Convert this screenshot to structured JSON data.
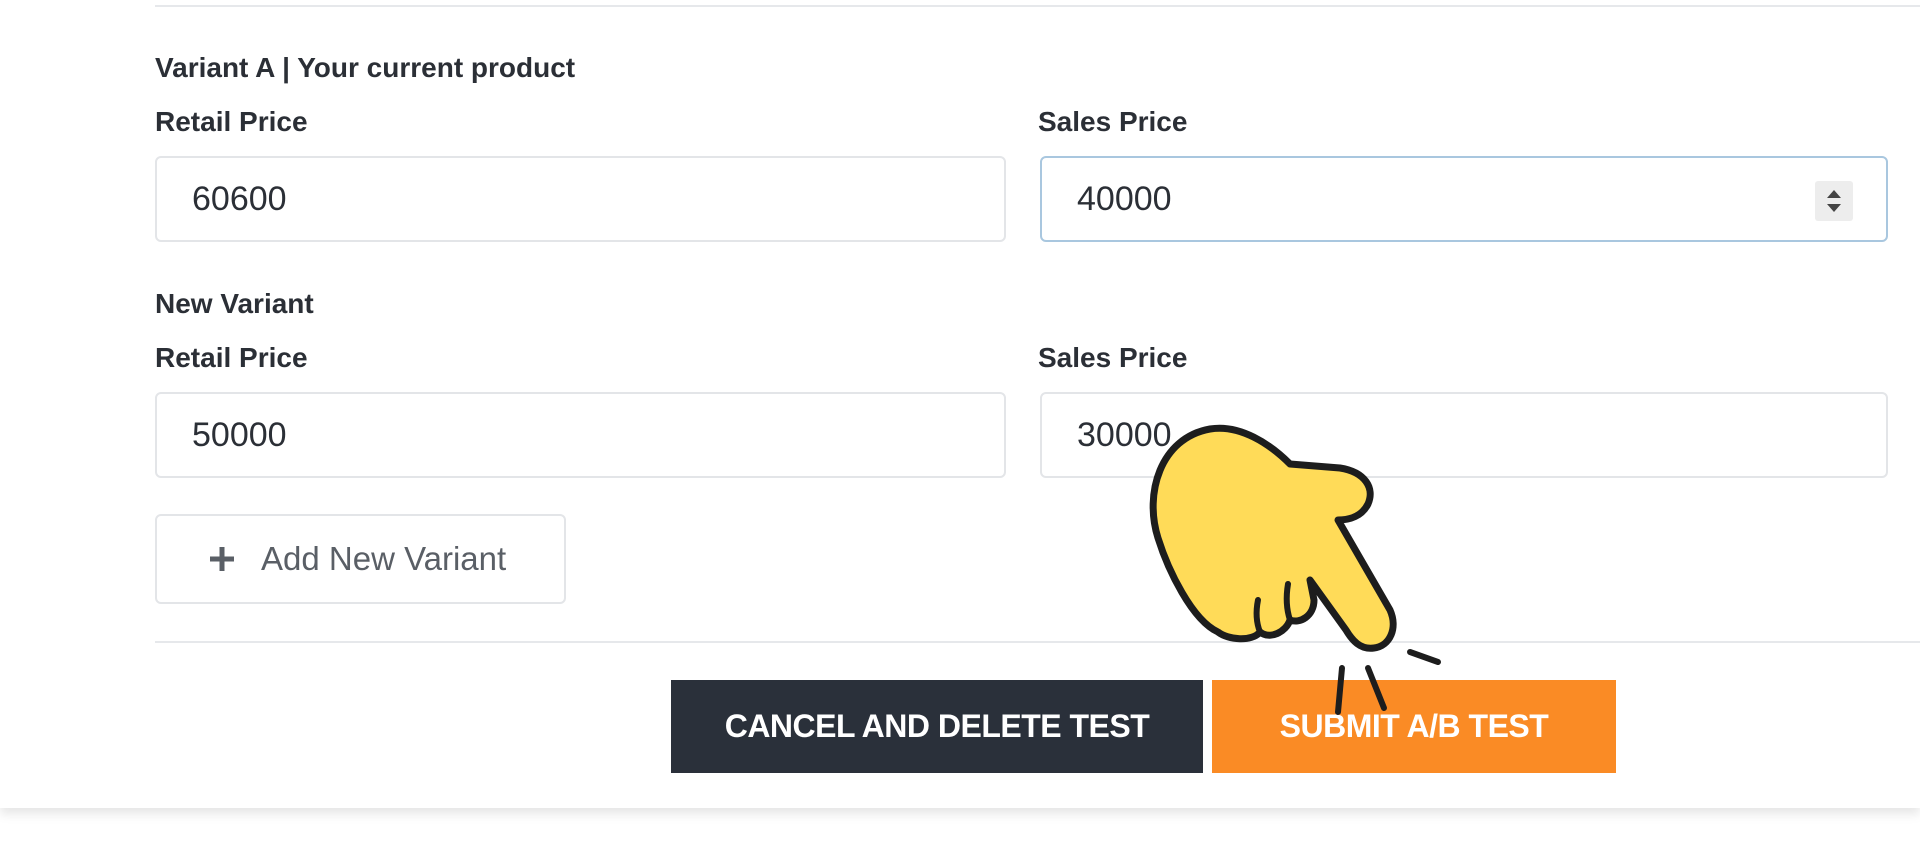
{
  "variant_a": {
    "heading": "Variant A | Your current product",
    "retail_label": "Retail Price",
    "retail_value": "60600",
    "sales_label": "Sales Price",
    "sales_value": "40000"
  },
  "new_variant": {
    "heading": "New Variant",
    "retail_label": "Retail Price",
    "retail_value": "50000",
    "sales_label": "Sales Price",
    "sales_value": "30000"
  },
  "add_variant": {
    "label": "Add New Variant",
    "icon": "plus-icon"
  },
  "actions": {
    "cancel_label": "CANCEL AND DELETE TEST",
    "submit_label": "SUBMIT A/B TEST"
  },
  "colors": {
    "cancel_bg": "#2a303a",
    "submit_bg": "#fa8b25",
    "focus_border": "#a9c7df",
    "hand_fill": "#ffdb58"
  },
  "overlay": {
    "icon": "pointing-hand-icon"
  }
}
